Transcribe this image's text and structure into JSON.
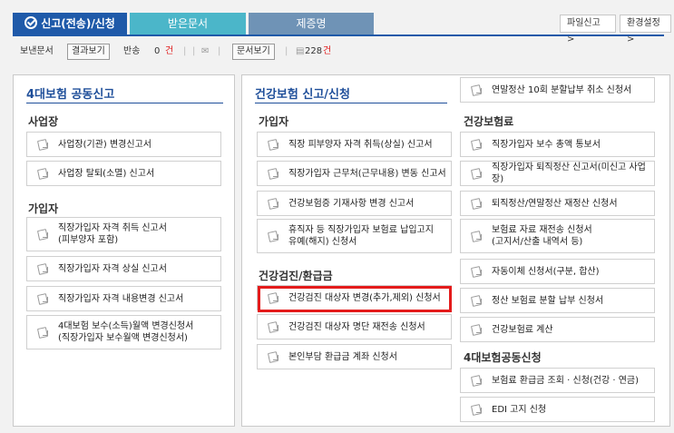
{
  "tabs": {
    "active": "신고(전송)/신청",
    "received": "받은문서",
    "certificate": "제증명"
  },
  "top_buttons": {
    "file_report": "파일신고 >",
    "env_settings": "환경설정 >"
  },
  "toolbar": {
    "sent_docs": "보낸문서",
    "result_view": "결과보기",
    "returned": "반송",
    "returned_count": "0",
    "count_unit": "건",
    "doc_view": "문서보기",
    "doc_count": "228",
    "doc_unit": "건"
  },
  "left_panel": {
    "title": "4대보험 공동신고",
    "sections": [
      {
        "title": "사업장",
        "items": [
          "사업장(기관) 변경신고서",
          "사업장 탈퇴(소멸) 신고서"
        ]
      },
      {
        "title": "가입자",
        "items": [
          "직장가입자 자격 취득 신고서\n(피부양자 포함)",
          "직장가입자 자격 상실 신고서",
          "직장가입자 자격 내용변경 신고서",
          "4대보험 보수(소득)월액 변경신청서\n(직장가입자 보수월액 변경신청서)"
        ]
      }
    ]
  },
  "right_panel": {
    "title": "건강보험 신고/신청",
    "top_item": "연말정산 10회 분할납부 취소 신청서",
    "col1": [
      {
        "title": "가입자",
        "items": [
          "직장 피부양자 자격 취득(상실) 신고서",
          "직장가입자 근무처(근무내용) 변동 신고서",
          "건강보험증 기재사항 변경 신고서",
          "휴직자 등 직장가입자 보험료 납입고지\n유예(해지) 신청서"
        ]
      },
      {
        "title": "건강검진/환급금",
        "items": [
          "건강검진 대상자 변경(추가,제외) 신청서",
          "건강검진 대상자 명단 재전송 신청서",
          "본인부담 환급금 계좌 신청서"
        ]
      }
    ],
    "col2": [
      {
        "title": "건강보험료",
        "items": [
          "직장가입자 보수 총액 통보서",
          "직장가입자 퇴직정산 신고서(미신고 사업장)",
          "퇴직정산/연말정산 재정산 신청서",
          "보험료 자료 재전송 신청서\n(고지서/산출 내역서 등)",
          "자동이체 신청서(구분, 합산)",
          "정산 보험료 분할 납부 신청서",
          "건강보험료 계산"
        ]
      },
      {
        "title": "4대보험공동신청",
        "items": [
          "보험료 환급금 조회 · 신청(건강 · 연금)",
          "EDI 고지 신청"
        ]
      }
    ]
  }
}
